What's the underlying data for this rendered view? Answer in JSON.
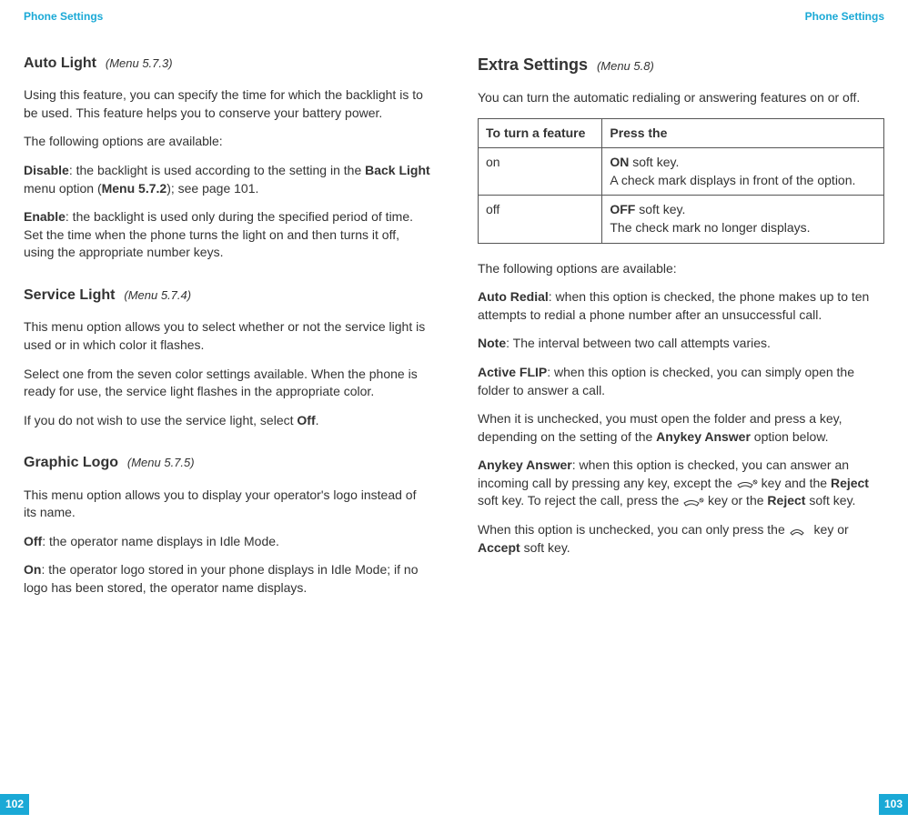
{
  "left": {
    "running_head": "Phone Settings",
    "page_num": "102",
    "sections": {
      "auto_light": {
        "title": "Auto Light",
        "menu": "(Menu 5.7.3)",
        "p1": "Using this feature, you can specify the time for which the backlight is to be used. This feature helps you to conserve your battery power.",
        "p2": "The following options are available:",
        "disable_label": "Disable",
        "disable_a": ": the backlight is used according to the setting in the ",
        "back_light": "Back Light",
        "disable_b": " menu option (",
        "menu572": "Menu 5.7.2",
        "disable_c": "); see page 101.",
        "enable_label": "Enable",
        "enable_text": ": the backlight is used only during the specified period of time. Set the time when the phone turns the light on and then turns it off, using the appropriate number keys."
      },
      "service_light": {
        "title": "Service Light",
        "menu": "(Menu 5.7.4)",
        "p1": "This menu option allows you to select whether or not the service light is used or in which color it flashes.",
        "p2": "Select one from the seven color settings available. When the phone is ready for use, the service light flashes in the appropriate color.",
        "p3a": "If you do not wish to use the service light, select ",
        "off": "Off",
        "p3b": "."
      },
      "graphic_logo": {
        "title": "Graphic Logo",
        "menu": "(Menu 5.7.5)",
        "p1": "This menu option allows you to display your operator's logo instead of its name.",
        "off_label": "Off",
        "off_text": ": the operator name displays in Idle Mode.",
        "on_label": "On",
        "on_text": ": the operator logo stored in your phone displays in Idle Mode; if no logo has been stored, the operator name displays."
      }
    }
  },
  "right": {
    "running_head": "Phone Settings",
    "page_num": "103",
    "sections": {
      "extra_settings": {
        "title": "Extra Settings",
        "menu": "(Menu 5.8)",
        "intro": "You can turn the automatic redialing or answering features on or off.",
        "th1": "To turn a feature",
        "th2": "Press the",
        "row1_c1": "on",
        "row1_c2_bold": "ON",
        "row1_c2_a": " soft key.",
        "row1_c2_b": "A check mark displays in front of the option.",
        "row2_c1": "off",
        "row2_c2_bold": "OFF",
        "row2_c2_a": " soft key.",
        "row2_c2_b": "The check mark no longer displays.",
        "avail": "The following options are available:",
        "auto_redial_label": "Auto Redial",
        "auto_redial_text": ": when this option is checked, the phone makes up to ten attempts to redial a phone number after an unsuccessful call.",
        "note_label": "Note",
        "note_text": ": The interval between two call attempts varies.",
        "active_flip_label": "Active FLIP",
        "active_flip_text": ": when this option is checked, you can simply open the folder to answer a call.",
        "flip_unchecked_a": "When it is unchecked, you must open the folder and press a key, depending on the setting of the ",
        "anykey_bold1": "Anykey Answer",
        "flip_unchecked_b": " option below.",
        "anykey_label": "Anykey Answer",
        "anykey_a": ": when this option is checked, you can answer an incoming call by pressing any key, except the ",
        "anykey_b": " key and the ",
        "reject1": "Reject",
        "anykey_c": " soft key. To reject the call, press the ",
        "anykey_d": " key or the ",
        "reject2": "Reject",
        "anykey_e": " soft key.",
        "unchecked_a": "When this option is unchecked, you can only press the ",
        "unchecked_b": " key or ",
        "accept": "Accept",
        "unchecked_c": " soft key."
      }
    }
  }
}
